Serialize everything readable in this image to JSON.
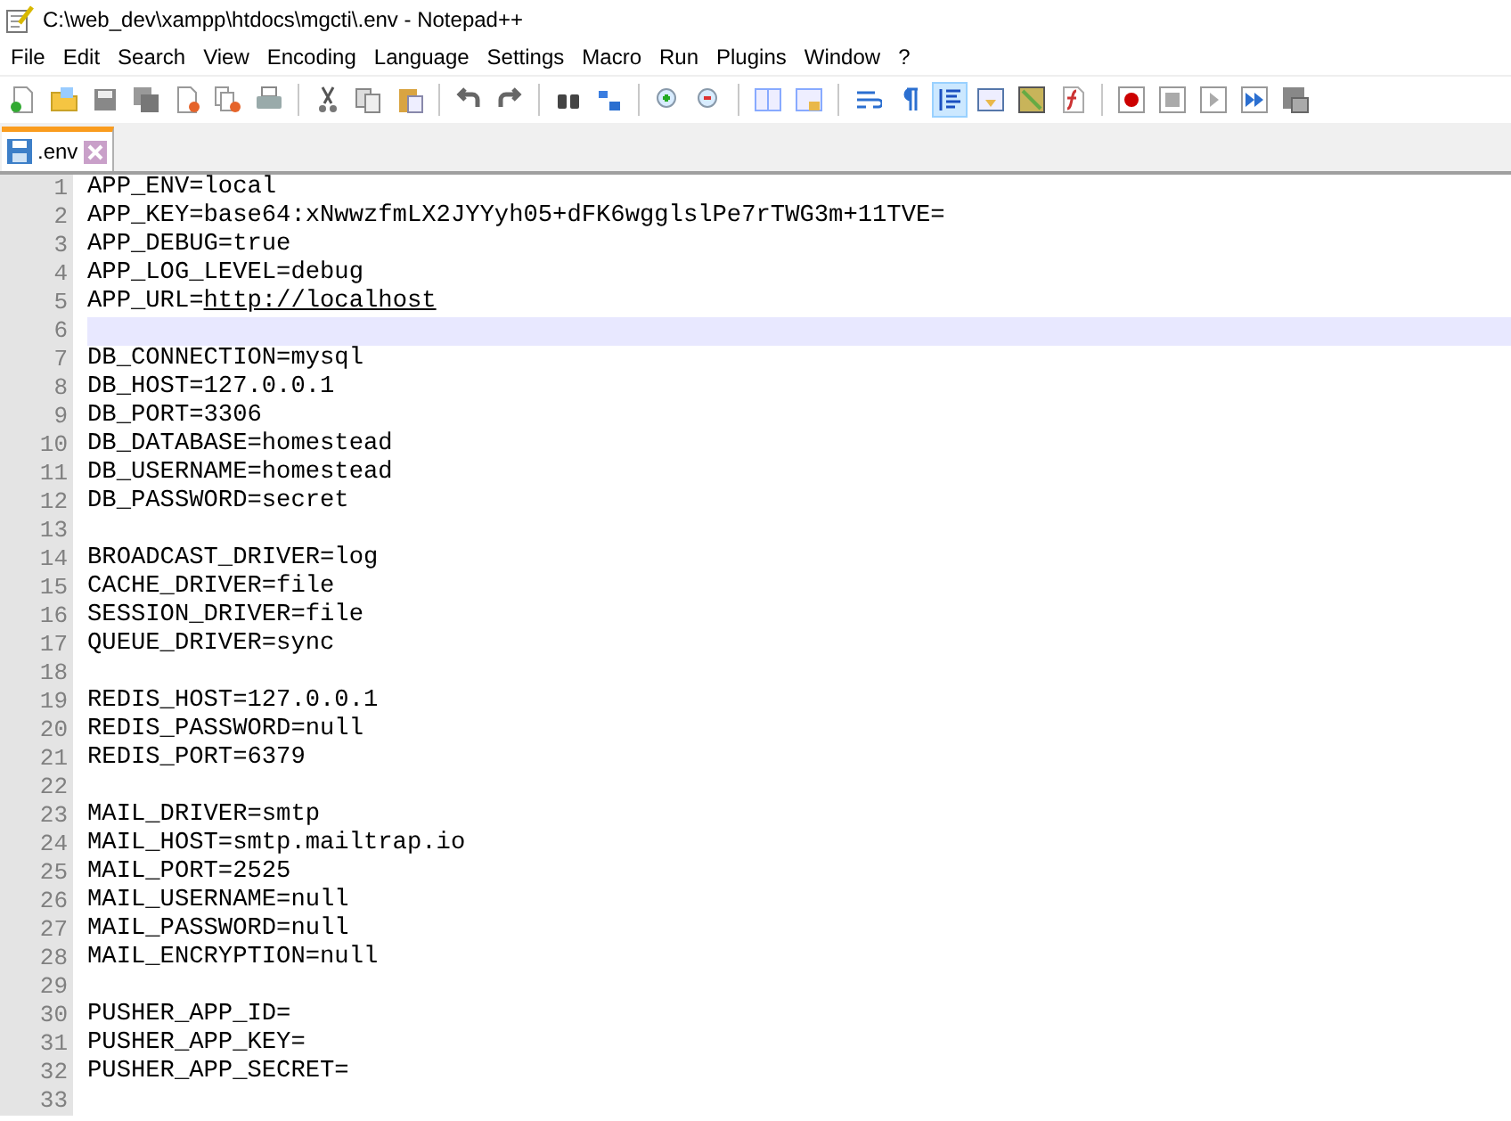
{
  "window": {
    "title": "C:\\web_dev\\xampp\\htdocs\\mgcti\\.env - Notepad++"
  },
  "menu": [
    "File",
    "Edit",
    "Search",
    "View",
    "Encoding",
    "Language",
    "Settings",
    "Macro",
    "Run",
    "Plugins",
    "Window",
    "?"
  ],
  "toolbar": [
    {
      "kind": "new",
      "selected": false
    },
    {
      "kind": "open",
      "selected": false
    },
    {
      "kind": "save",
      "selected": false
    },
    {
      "kind": "saveall",
      "selected": false
    },
    {
      "kind": "close",
      "selected": false
    },
    {
      "kind": "closeall",
      "selected": false
    },
    {
      "kind": "print",
      "selected": false
    },
    {
      "kind": "sep"
    },
    {
      "kind": "cut",
      "selected": false
    },
    {
      "kind": "copy",
      "selected": false
    },
    {
      "kind": "paste",
      "selected": false
    },
    {
      "kind": "sep"
    },
    {
      "kind": "undo",
      "selected": false
    },
    {
      "kind": "redo",
      "selected": false
    },
    {
      "kind": "sep"
    },
    {
      "kind": "find",
      "selected": false
    },
    {
      "kind": "replace",
      "selected": false
    },
    {
      "kind": "sep"
    },
    {
      "kind": "zoomin",
      "selected": false
    },
    {
      "kind": "zoomout",
      "selected": false
    },
    {
      "kind": "sep"
    },
    {
      "kind": "syncv",
      "selected": false
    },
    {
      "kind": "synch",
      "selected": false
    },
    {
      "kind": "sep"
    },
    {
      "kind": "wrap",
      "selected": false
    },
    {
      "kind": "allchars",
      "selected": false
    },
    {
      "kind": "indent",
      "selected": true
    },
    {
      "kind": "udl",
      "selected": false
    },
    {
      "kind": "docmap",
      "selected": false
    },
    {
      "kind": "funclist",
      "selected": false
    },
    {
      "kind": "sep"
    },
    {
      "kind": "record",
      "selected": false
    },
    {
      "kind": "stop",
      "selected": false
    },
    {
      "kind": "play",
      "selected": false
    },
    {
      "kind": "playmulti",
      "selected": false
    },
    {
      "kind": "savemacro",
      "selected": false
    }
  ],
  "tabs": [
    {
      "label": ".env",
      "selected": true
    }
  ],
  "lines": [
    {
      "number": "1",
      "text": "APP_ENV=local",
      "current": false
    },
    {
      "number": "2",
      "text": "APP_KEY=base64:xNwwzfmLX2JYYyh05+dFK6wgglslPe7rTWG3m+11TVE=",
      "current": false
    },
    {
      "number": "3",
      "text": "APP_DEBUG=true",
      "current": false
    },
    {
      "number": "4",
      "text": "APP_LOG_LEVEL=debug",
      "current": false
    },
    {
      "number": "5",
      "text": "APP_URL=",
      "link": "http://localhost",
      "current": false
    },
    {
      "number": "6",
      "current": true
    },
    {
      "number": "7",
      "text": "DB_CONNECTION=mysql",
      "current": false
    },
    {
      "number": "8",
      "text": "DB_HOST=127.0.0.1",
      "current": false
    },
    {
      "number": "9",
      "text": "DB_PORT=3306",
      "current": false
    },
    {
      "number": "10",
      "text": "DB_DATABASE=homestead",
      "current": false
    },
    {
      "number": "11",
      "text": "DB_USERNAME=homestead",
      "current": false
    },
    {
      "number": "12",
      "text": "DB_PASSWORD=secret",
      "current": false
    },
    {
      "number": "13",
      "current": false
    },
    {
      "number": "14",
      "text": "BROADCAST_DRIVER=log",
      "current": false
    },
    {
      "number": "15",
      "text": "CACHE_DRIVER=file",
      "current": false
    },
    {
      "number": "16",
      "text": "SESSION_DRIVER=file",
      "current": false
    },
    {
      "number": "17",
      "text": "QUEUE_DRIVER=sync",
      "current": false
    },
    {
      "number": "18",
      "current": false
    },
    {
      "number": "19",
      "text": "REDIS_HOST=127.0.0.1",
      "current": false
    },
    {
      "number": "20",
      "text": "REDIS_PASSWORD=null",
      "current": false
    },
    {
      "number": "21",
      "text": "REDIS_PORT=6379",
      "current": false
    },
    {
      "number": "22",
      "current": false
    },
    {
      "number": "23",
      "text": "MAIL_DRIVER=smtp",
      "current": false
    },
    {
      "number": "24",
      "text": "MAIL_HOST=smtp.mailtrap.io",
      "current": false
    },
    {
      "number": "25",
      "text": "MAIL_PORT=2525",
      "current": false
    },
    {
      "number": "26",
      "text": "MAIL_USERNAME=null",
      "current": false
    },
    {
      "number": "27",
      "text": "MAIL_PASSWORD=null",
      "current": false
    },
    {
      "number": "28",
      "text": "MAIL_ENCRYPTION=null",
      "current": false
    },
    {
      "number": "29",
      "current": false
    },
    {
      "number": "30",
      "text": "PUSHER_APP_ID=",
      "current": false
    },
    {
      "number": "31",
      "text": "PUSHER_APP_KEY=",
      "current": false
    },
    {
      "number": "32",
      "text": "PUSHER_APP_SECRET=",
      "current": false
    },
    {
      "number": "33",
      "current": false
    }
  ]
}
